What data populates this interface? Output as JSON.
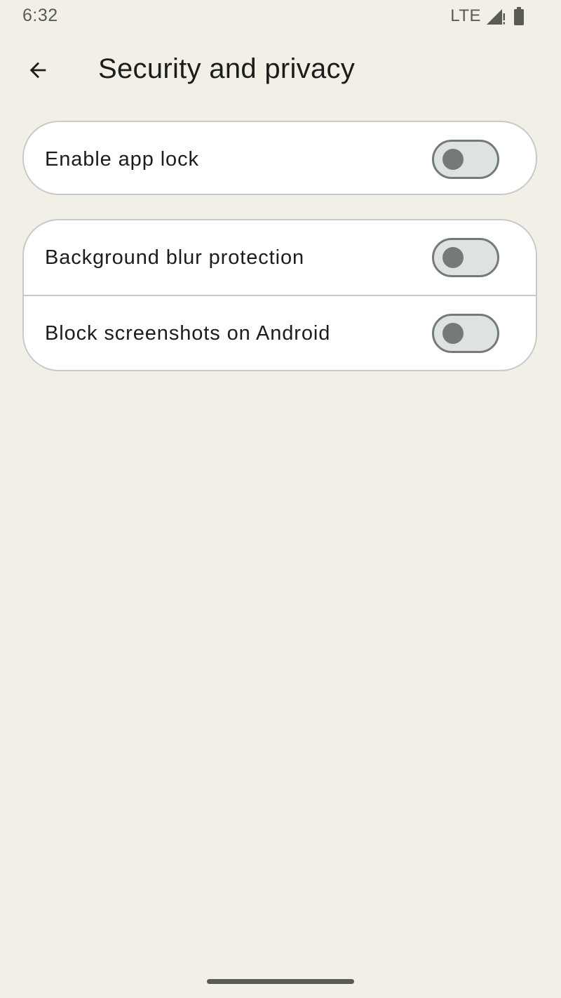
{
  "status_bar": {
    "time": "6:32",
    "network": "LTE",
    "icons": [
      "signal-icon",
      "battery-icon"
    ]
  },
  "app_bar": {
    "back_icon": "arrow-back-icon",
    "title": "Security and privacy"
  },
  "settings": {
    "app_lock": {
      "label": "Enable app lock",
      "enabled": false
    },
    "background_blur": {
      "label": "Background blur protection",
      "enabled": false
    },
    "block_screenshots": {
      "label": "Block screenshots on Android",
      "enabled": false
    }
  },
  "colors": {
    "background": "#f2f0e6",
    "card": "#ffffff",
    "card_border": "#c6cbc6",
    "switch_track_off": "#dfe3df",
    "switch_outline": "#747a75"
  }
}
